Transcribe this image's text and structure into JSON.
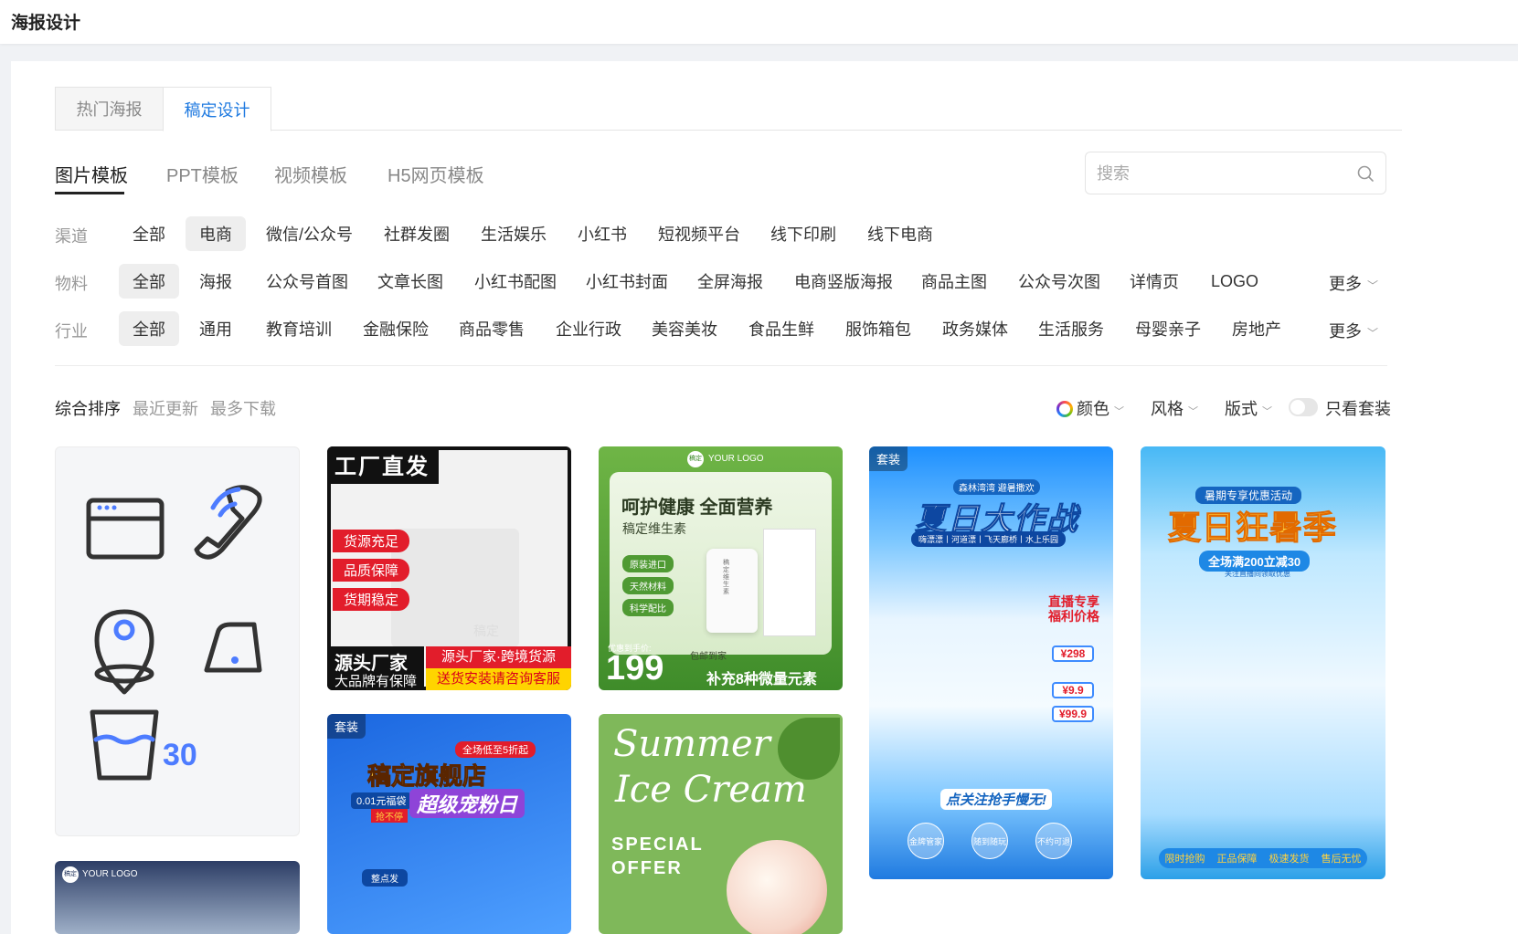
{
  "header": {
    "title": "海报设计"
  },
  "tabs": [
    {
      "label": "热门海报"
    },
    {
      "label": "稿定设计"
    }
  ],
  "subnav": [
    {
      "label": "图片模板"
    },
    {
      "label": "PPT模板"
    },
    {
      "label": "视频模板"
    },
    {
      "label": "H5网页模板"
    }
  ],
  "search": {
    "placeholder": "搜索"
  },
  "filters": {
    "channel": {
      "label": "渠道",
      "items": [
        "全部",
        "电商",
        "微信/公众号",
        "社群发圈",
        "生活娱乐",
        "小红书",
        "短视频平台",
        "线下印刷",
        "线下电商"
      ],
      "selected": "电商"
    },
    "material": {
      "label": "物料",
      "items": [
        "全部",
        "海报",
        "公众号首图",
        "文章长图",
        "小红书配图",
        "小红书封面",
        "全屏海报",
        "电商竖版海报",
        "商品主图",
        "公众号次图",
        "详情页",
        "LOGO"
      ],
      "selected": "全部",
      "more": "更多"
    },
    "industry": {
      "label": "行业",
      "items": [
        "全部",
        "通用",
        "教育培训",
        "金融保险",
        "商品零售",
        "企业行政",
        "美容美妆",
        "食品生鲜",
        "服饰箱包",
        "政务媒体",
        "生活服务",
        "母婴亲子",
        "房地产"
      ],
      "selected": "全部",
      "more": "更多"
    }
  },
  "sort": {
    "options": [
      "综合排序",
      "最近更新",
      "最多下载"
    ],
    "active": "综合排序"
  },
  "right_filters": {
    "color": "颜色",
    "style": "风格",
    "layout": "版式",
    "only_sets": "只看套装",
    "only_sets_on": false
  },
  "cards": {
    "c1": {
      "number": "30"
    },
    "c2": {
      "title": "工厂直发",
      "bullets": [
        "货源充足",
        "品质保障",
        "货期稳定"
      ],
      "watermark": "稿定",
      "left_big": "源头厂家",
      "left_small": "大品牌有保障",
      "right_top": "源头厂家·跨境货源",
      "right_bottom": "送货安装请咨询客服"
    },
    "c3": {
      "logo": "YOUR LOGO",
      "logo_mark": "稿定",
      "headline": "呵护健康 全面营养",
      "sub": "稿定维生素",
      "tags": [
        "原装进口",
        "天然材料",
        "科学配比"
      ],
      "price_label": "优惠到手价:",
      "price": "199",
      "shipping": "包邮到家",
      "footer": "补充8种微量元素",
      "bottle_label": "稿定维生素"
    },
    "c4": {
      "badge": "套装",
      "top_small": "森林湾湾 避暑撒欢",
      "title": "夏日大作战",
      "subtitle": "嗨漂漂丨河道漂丨飞天廊桥丨水上乐园",
      "side_title1": "直播专享",
      "side_title2": "福利价格",
      "prices": [
        "¥298",
        "¥9.9",
        "¥99.9"
      ],
      "slogan": "点关注抢手慢无!",
      "circles": [
        "金牌管家",
        "随到随玩",
        "不约可退"
      ]
    },
    "c5": {
      "top": "暑期专享优惠活动",
      "title": "夏日狂暑季",
      "promo": "全场满200立减30",
      "promo_small": "关注直播间领取优惠",
      "footer": [
        "限时抢购",
        "正品保障",
        "极速发货",
        "售后无忧"
      ]
    },
    "c6": {
      "badge": "套装",
      "ribbon": "全场低至5折起",
      "title": "稿定旗舰店",
      "sub_left": "0.01元福袋",
      "sub_left2": "抢不停",
      "sub_right": "超级宠粉日",
      "chip": "整点发"
    },
    "c7": {
      "line1": "Summer",
      "line2": "Ice Cream",
      "line3": "SPECIAL",
      "line4": "OFFER"
    },
    "c8": {
      "logo": "YOUR LOGO",
      "logo_mark": "稿定"
    }
  }
}
